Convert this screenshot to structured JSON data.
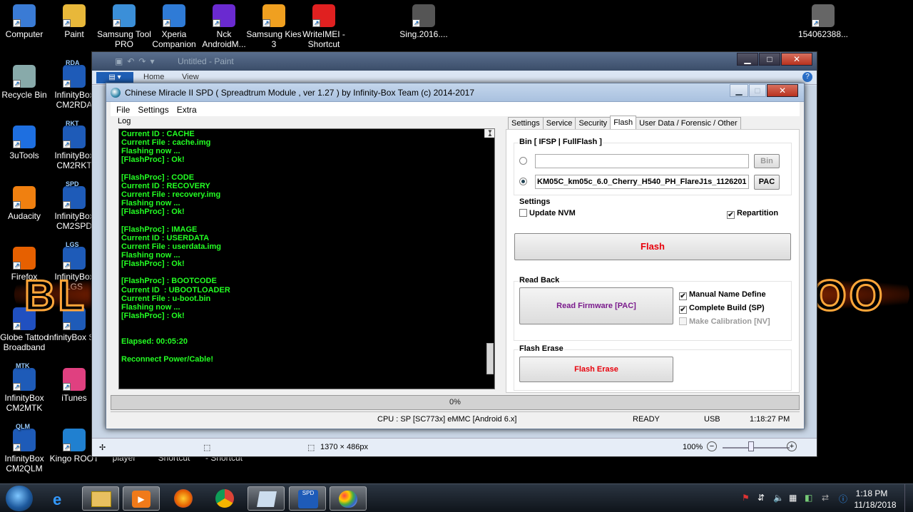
{
  "desktop_icons": [
    {
      "label": "Computer",
      "ic": "computer-icon",
      "color": "#3a7bd5"
    },
    {
      "label": "Paint",
      "ic": "paint-icon",
      "color": "#e8b83a"
    },
    {
      "label": "Samsung Tool PRO",
      "ic": "samsung-tool-icon",
      "color": "#3b8fd8"
    },
    {
      "label": "Xperia Companion",
      "ic": "xperia-icon",
      "color": "#2f7bd6"
    },
    {
      "label": "Nck AndroidM...",
      "ic": "nck-icon",
      "color": "#6a2ad0"
    },
    {
      "label": "Samsung Kies 3",
      "ic": "kies-icon",
      "color": "#f0a020"
    },
    {
      "label": "WriteIMEI - Shortcut",
      "ic": "writeimei-icon",
      "color": "#e02020"
    },
    {
      "label": "Sing.2016....",
      "ic": "video-file-icon",
      "color": "#555"
    },
    {
      "label": "154062388...",
      "ic": "image-file-icon",
      "color": "#666"
    },
    {
      "label": "Recycle Bin",
      "ic": "recycle-bin-icon",
      "color": "#8aa"
    },
    {
      "label": "InfinityBox CM2RDA",
      "ic": "infinitybox-icon",
      "color": "#1e5bb8",
      "badge": "RDA"
    },
    {
      "label": "3uTools",
      "ic": "3utools-icon",
      "color": "#1e6fe0"
    },
    {
      "label": "InfinityBox CM2RKT",
      "ic": "infinitybox-icon",
      "color": "#1e5bb8",
      "badge": "RKT"
    },
    {
      "label": "Audacity",
      "ic": "audacity-icon",
      "color": "#f08010"
    },
    {
      "label": "InfinityBox CM2SPD",
      "ic": "infinitybox-icon",
      "color": "#1e5bb8",
      "badge": "SPD"
    },
    {
      "label": "Firefox",
      "ic": "firefox-icon",
      "color": "#e66000"
    },
    {
      "label": "InfinityBox LGS",
      "ic": "infinitybox-icon",
      "color": "#1e5bb8",
      "badge": "LGS"
    },
    {
      "label": "Globe Tattoo Broadband",
      "ic": "globe-tattoo-icon",
      "color": "#2050c0"
    },
    {
      "label": "InfinityBox SM",
      "ic": "infinitybox-icon",
      "color": "#1e5bb8"
    },
    {
      "label": "InfinityBox CM2MTK",
      "ic": "infinitybox-icon",
      "color": "#1e5bb8",
      "badge": "MTK"
    },
    {
      "label": "iTunes",
      "ic": "itunes-icon",
      "color": "#e04080"
    },
    {
      "label": "InfinityBox CM2QLM",
      "ic": "infinitybox-icon",
      "color": "#1e5bb8",
      "badge": "QLM"
    },
    {
      "label": "Kingo ROOT",
      "ic": "kingo-root-icon",
      "color": "#2080d0"
    },
    {
      "label": "player",
      "ic": "none"
    },
    {
      "label": "Shortcut",
      "ic": "none"
    },
    {
      "label": "- Shortcut",
      "ic": "none"
    }
  ],
  "wallpaper_logo": {
    "left_text": "BL",
    "right_text": "OO"
  },
  "paint": {
    "title": "Untitled - Paint",
    "tabs": [
      "Home",
      "View"
    ],
    "status_size": "1370 × 486px",
    "zoom": "100%",
    "palette": [
      "#000000",
      "#7f7f7f",
      "#880015",
      "#ed1c24",
      "#ff7f27",
      "#fff200",
      "#22b14c",
      "#00a2e8",
      "#3f48cc",
      "#a349a4",
      "#ffffff",
      "#c3c3c3",
      "#b97a57",
      "#ffaec9",
      "#ffc90e"
    ]
  },
  "cm2": {
    "title": "Chinese Miracle II SPD ( Spreadtrum Module , ver 1.27 ) by Infinity-Box Team (c) 2014-2017",
    "menu": [
      "File",
      "Settings",
      "Extra"
    ],
    "log_label": "Log",
    "log_lines": [
      "Current ID : CACHE",
      "Current File : cache.img",
      "Flashing now ...",
      "[FlashProc] : Ok!",
      "",
      "[FlashProc] : CODE",
      "Current ID : RECOVERY",
      "Current File : recovery.img",
      "Flashing now ...",
      "[FlashProc] : Ok!",
      "",
      "[FlashProc] : IMAGE",
      "Current ID : USERDATA",
      "Current File : userdata.img",
      "Flashing now ...",
      "[FlashProc] : Ok!",
      "",
      "[FlashProc] : BOOTCODE",
      "Current ID  : UBOOTLOADER",
      "Current File : u-boot.bin",
      "Flashing now ...",
      "[FlashProc] : Ok!",
      "",
      "",
      "Elapsed: 00:05:20",
      "",
      "Reconnect Power/Cable!"
    ],
    "tabs": [
      "Settings",
      "Service",
      "Security",
      "Flash",
      "User Data / Forensic / Other"
    ],
    "active_tab": "Flash",
    "bin_group": "Bin  [ IFSP | FullFlash ]",
    "bin_value": "",
    "bin_button": "Bin",
    "pac_value": "KM05C_km05c_6.0_Cherry_H540_PH_FlareJ1s_1126201",
    "pac_button": "PAC",
    "settings_group": "Settings",
    "update_nvm": "Update NVM",
    "repartition": "Repartition",
    "flash_button": "Flash",
    "readback_group": "Read Back",
    "read_firmware_button": "Read Firmware [PAC]",
    "manual_name": "Manual Name Define",
    "complete_build": "Complete Build (SP)",
    "make_calibration": "Make Calibration [NV]",
    "erase_group": "Flash Erase",
    "flash_erase_button": "Flash Erase",
    "progress": "0%",
    "status_cpu": "CPU : SP [SC773x] eMMC [Android 6.x]",
    "status_state": "READY",
    "status_port": "USB",
    "status_time": "1:18:27 PM",
    "colors": {
      "flash_red": "#e8000b",
      "readfw_purple": "#7a1a8c",
      "log_green": "#23ff23"
    }
  },
  "taskbar": {
    "time": "1:18 PM",
    "date": "11/18/2018"
  }
}
